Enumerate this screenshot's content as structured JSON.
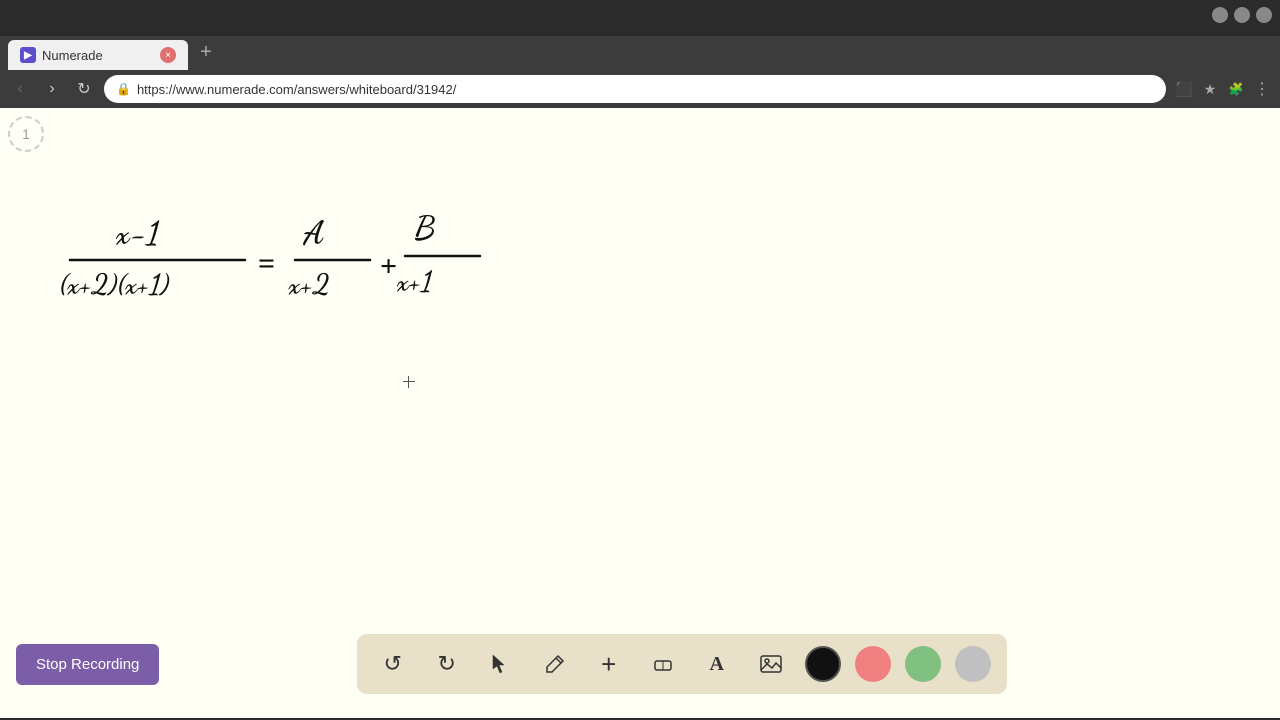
{
  "browser": {
    "tab_title": "Numerade",
    "tab_favicon": "N",
    "url": "https://www.numerade.com/answers/whiteboard/31942/",
    "new_tab_label": "+",
    "nav": {
      "back_label": "‹",
      "forward_label": "›",
      "refresh_label": "↻"
    }
  },
  "whiteboard": {
    "number_indicator": "1",
    "background_color": "#fffff5"
  },
  "toolbar": {
    "stop_recording_label": "Stop Recording",
    "tools": [
      {
        "name": "undo",
        "icon": "↺"
      },
      {
        "name": "redo",
        "icon": "↻"
      },
      {
        "name": "select",
        "icon": "▲"
      },
      {
        "name": "pen",
        "icon": "✎"
      },
      {
        "name": "add",
        "icon": "+"
      },
      {
        "name": "eraser",
        "icon": "◫"
      },
      {
        "name": "text",
        "icon": "A"
      },
      {
        "name": "image",
        "icon": "▨"
      }
    ],
    "colors": [
      {
        "name": "black",
        "value": "#111111"
      },
      {
        "name": "pink",
        "value": "#f08080"
      },
      {
        "name": "green",
        "value": "#80c080"
      },
      {
        "name": "gray",
        "value": "#c0c0c0"
      }
    ]
  }
}
